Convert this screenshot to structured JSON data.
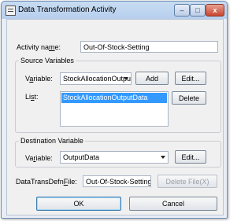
{
  "window": {
    "title": "Data Transformation Activity",
    "minimize_glyph": "–",
    "maximize_glyph": "□",
    "close_glyph": "x"
  },
  "activity": {
    "label_prefix": "Activity na",
    "label_mnemonic": "m",
    "label_suffix": "e:",
    "value": "Out-Of-Stock-Setting"
  },
  "source": {
    "group_title": "Source Variables",
    "variable_label_prefix": "V",
    "variable_label_mnemonic": "a",
    "variable_label_suffix": "riable:",
    "variable_selected": "StockAllocationOutput",
    "add_button": "Add",
    "edit_button": "Edit...",
    "list_label_prefix": "Li",
    "list_label_mnemonic": "s",
    "list_label_suffix": "t:",
    "list_items": [
      "StockAllocationOutputData"
    ],
    "delete_button": "Delete"
  },
  "destination": {
    "group_title": "Destination Variable",
    "variable_label_prefix": "Va",
    "variable_label_mnemonic": "r",
    "variable_label_suffix": "iable:",
    "variable_selected": "OutputData",
    "edit_button": "Edit..."
  },
  "file": {
    "label_prefix": "DataTransDefn",
    "label_mnemonic": "F",
    "label_suffix": "ile:",
    "value": "Out-Of-Stock-Setting",
    "delete_file_button": "Delete File(X)"
  },
  "footer": {
    "ok_button": "OK",
    "cancel_button": "Cancel"
  }
}
